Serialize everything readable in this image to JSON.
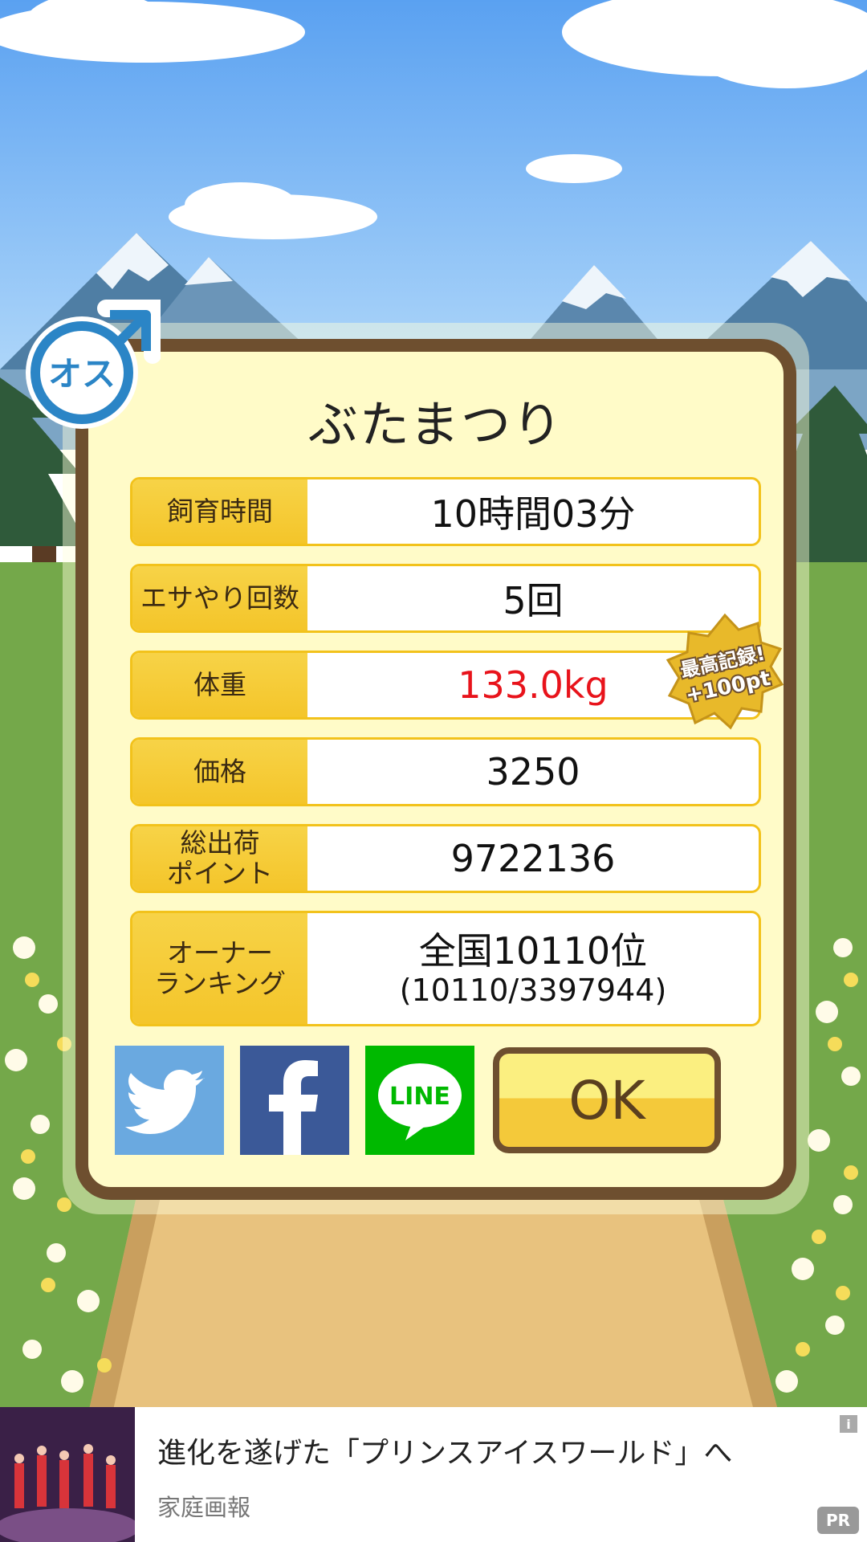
{
  "game": {
    "pig_name": "ぶたまつり",
    "sex_label": "オス",
    "stats": [
      {
        "label": "飼育時間",
        "value": "10時間03分"
      },
      {
        "label": "エサやり回数",
        "value": "5回"
      },
      {
        "label": "体重",
        "value": "133.0kg"
      },
      {
        "label": "価格",
        "value": "3250"
      },
      {
        "label": "総出荷\nポイント",
        "value": "9722136"
      }
    ],
    "ranking": {
      "label": "オーナー\nランキング",
      "line1": "全国10110位",
      "line2": "(10110/3397944)"
    },
    "record_badge": {
      "line1": "最高記録!",
      "line2": "+100pt"
    },
    "share": {
      "twitter_icon": "twitter-bird-icon",
      "facebook_icon": "facebook-f-icon",
      "line_label": "LINE"
    },
    "ok_label": "OK"
  },
  "ad": {
    "title": "進化を遂げた「プリンスアイスワールド」へ",
    "source": "家庭画報",
    "pr_label": "PR",
    "info_label": "i"
  },
  "colors": {
    "sky": "#6fb0f4",
    "grass": "#74a84a",
    "path": "#e8c27e",
    "panel_bg": "#fffbc8",
    "panel_border": "#6e4f2f",
    "label_yellow": "#f4c52a",
    "record_red": "#e8131b",
    "twitter": "#6aa9e0",
    "facebook": "#3b5998",
    "line": "#00b900"
  }
}
